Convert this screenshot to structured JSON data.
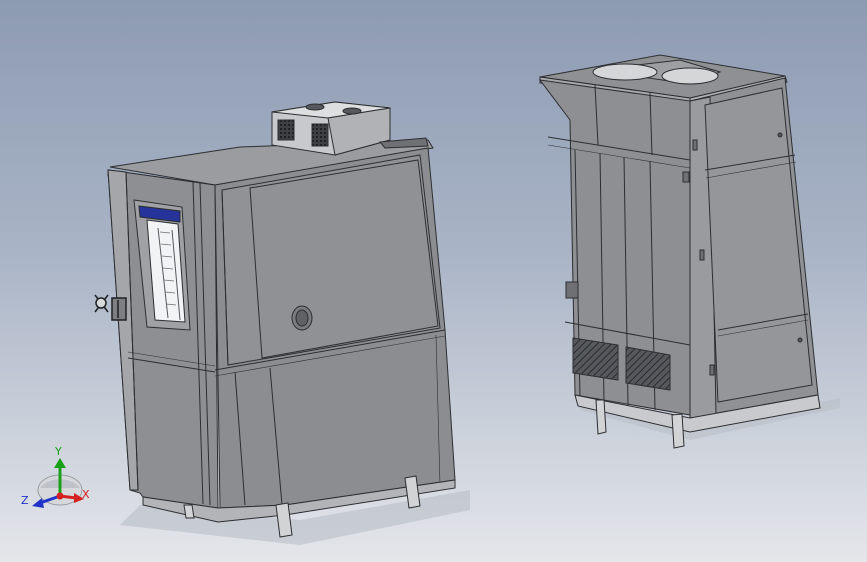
{
  "scene": {
    "background_top": "#8d9bb2",
    "background_bottom": "#e4e6ea",
    "body_color": "#8e9093",
    "edge_color": "#2c2e31",
    "accent_color": "#25339a"
  },
  "triad": {
    "x_label": "X",
    "y_label": "Y",
    "z_label": "Z",
    "x_color": "#d42020",
    "y_color": "#18a018",
    "z_color": "#2033c8"
  }
}
